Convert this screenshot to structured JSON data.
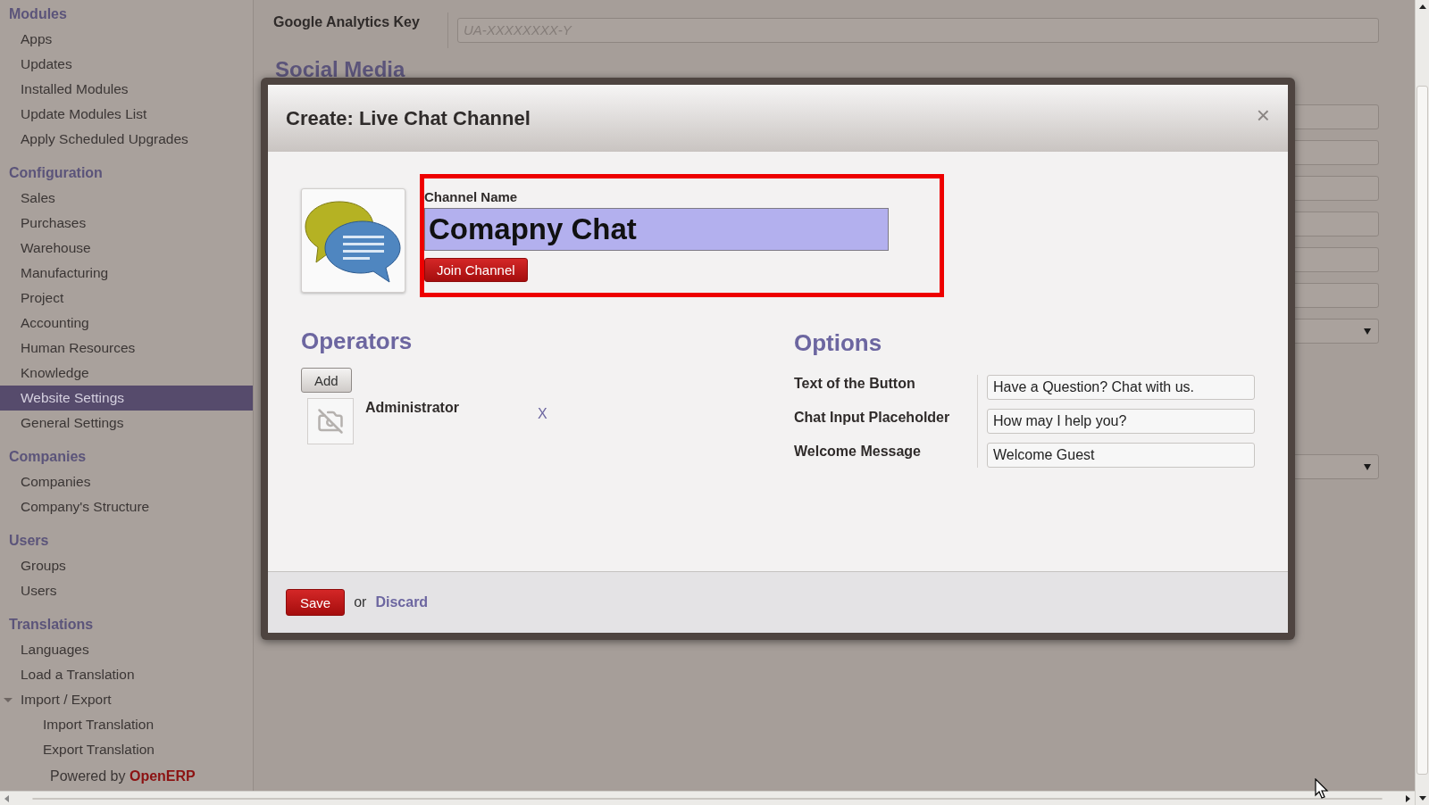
{
  "sidebar": {
    "sections": [
      {
        "title": "Modules",
        "items": [
          {
            "label": "Apps",
            "selected": false
          },
          {
            "label": "Updates",
            "selected": false
          },
          {
            "label": "Installed Modules",
            "selected": false
          },
          {
            "label": "Update Modules List",
            "selected": false
          },
          {
            "label": "Apply Scheduled Upgrades",
            "selected": false
          }
        ]
      },
      {
        "title": "Configuration",
        "items": [
          {
            "label": "Sales",
            "selected": false
          },
          {
            "label": "Purchases",
            "selected": false
          },
          {
            "label": "Warehouse",
            "selected": false
          },
          {
            "label": "Manufacturing",
            "selected": false
          },
          {
            "label": "Project",
            "selected": false
          },
          {
            "label": "Accounting",
            "selected": false
          },
          {
            "label": "Human Resources",
            "selected": false
          },
          {
            "label": "Knowledge",
            "selected": false
          },
          {
            "label": "Website Settings",
            "selected": true
          },
          {
            "label": "General Settings",
            "selected": false
          }
        ]
      },
      {
        "title": "Companies",
        "items": [
          {
            "label": "Companies",
            "selected": false
          },
          {
            "label": "Company's Structure",
            "selected": false
          }
        ]
      },
      {
        "title": "Users",
        "items": [
          {
            "label": "Groups",
            "selected": false
          },
          {
            "label": "Users",
            "selected": false
          }
        ]
      },
      {
        "title": "Translations",
        "items": [
          {
            "label": "Languages",
            "selected": false
          },
          {
            "label": "Load a Translation",
            "selected": false
          },
          {
            "label": "Import / Export",
            "selected": false,
            "expanded": true,
            "children": [
              {
                "label": "Import Translation",
                "selected": false
              },
              {
                "label": "Export Translation",
                "selected": false
              }
            ]
          }
        ]
      }
    ],
    "footer": {
      "prefix": "Powered by",
      "brand": "OpenERP"
    }
  },
  "background_form": {
    "analytics_label": "Google Analytics Key",
    "analytics_placeholder": "UA-XXXXXXXX-Y",
    "section_title": "Social Media",
    "fields": [
      {
        "kind": "text"
      },
      {
        "kind": "text"
      },
      {
        "kind": "text"
      },
      {
        "kind": "text"
      },
      {
        "kind": "text"
      },
      {
        "kind": "text"
      },
      {
        "kind": "select"
      },
      {
        "kind": "select"
      }
    ]
  },
  "dialog": {
    "title": "Create: Live Chat Channel",
    "close": "×",
    "name_label": "Channel Name",
    "name_value": "Comapny Chat",
    "join_button": "Join Channel",
    "operators": {
      "title": "Operators",
      "add_button": "Add",
      "list": [
        {
          "name": "Administrator",
          "remove": "X"
        }
      ]
    },
    "options": {
      "title": "Options",
      "rows": [
        {
          "label": "Text of the Button",
          "value": "Have a Question? Chat with us."
        },
        {
          "label": "Chat Input Placeholder",
          "value": "How may I help you?"
        },
        {
          "label": "Welcome Message",
          "value": "Welcome Guest"
        }
      ]
    },
    "footer": {
      "save": "Save",
      "or": "or",
      "discard": "Discard"
    }
  }
}
